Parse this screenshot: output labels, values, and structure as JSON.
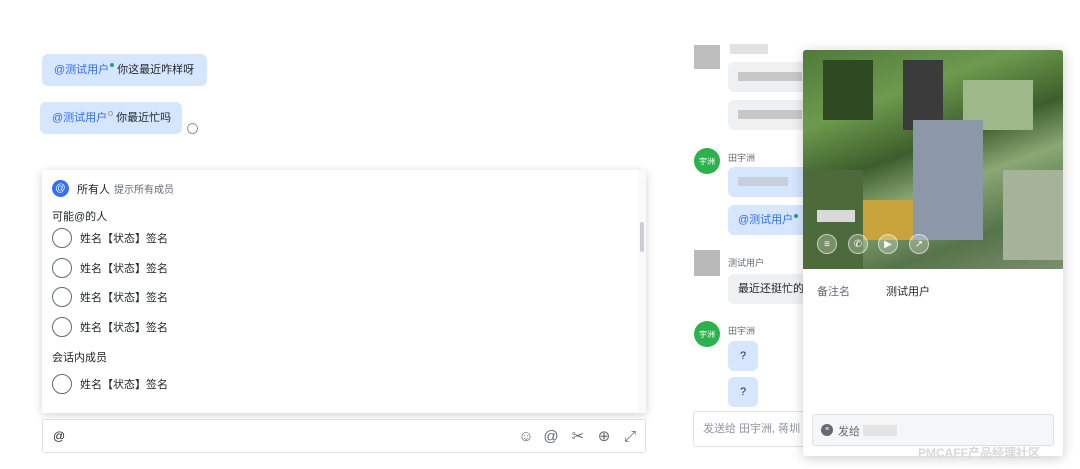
{
  "left_chat": {
    "messages": [
      {
        "mention": "@测试用户",
        "text": "你这最近咋样呀"
      },
      {
        "mention": "@测试用户",
        "text": "你最近忙吗"
      }
    ]
  },
  "mention_popup": {
    "all": {
      "label": "所有人",
      "hint": "提示所有成员",
      "icon": "@"
    },
    "section_possible": "可能@的人",
    "possible_people": [
      "姓名【状态】签名",
      "姓名【状态】签名",
      "姓名【状态】签名",
      "姓名【状态】签名"
    ],
    "section_members": "会话内成员",
    "members": [
      "姓名【状态】签名"
    ]
  },
  "input": {
    "value": "@",
    "tools": [
      "emoji-icon",
      "at-icon",
      "scissors-icon",
      "plus-circle-icon",
      "expand-icon"
    ],
    "tool_glyphs": [
      "☺",
      "@",
      "✂",
      "⊕",
      "⤢"
    ]
  },
  "right_chat": {
    "sender1_avatar": "宇洲",
    "sender1_name": "田宇洲",
    "mention_bubble": "@测试用户",
    "sender2_name": "测试用户",
    "sender2_message": "最近还挺忙的",
    "sender3_avatar": "宇洲",
    "sender3_name": "田宇洲",
    "q1": "?",
    "q2": "?",
    "input_placeholder": "发送给 田宇洲, 蒋圳"
  },
  "profile_card": {
    "field_label": "备注名",
    "field_value": "测试用户",
    "actions": [
      "chat-icon",
      "phone-icon",
      "video-icon",
      "share-icon"
    ],
    "action_glyphs": [
      "≡",
      "✆",
      "▶",
      "↗"
    ],
    "send_prefix": "发给"
  },
  "watermark": "PMCAFF产品经理社区",
  "colors": {
    "accent": "#3370ff",
    "bubble_blue": "#d6e6ff",
    "green_avatar": "#2bb24c"
  }
}
